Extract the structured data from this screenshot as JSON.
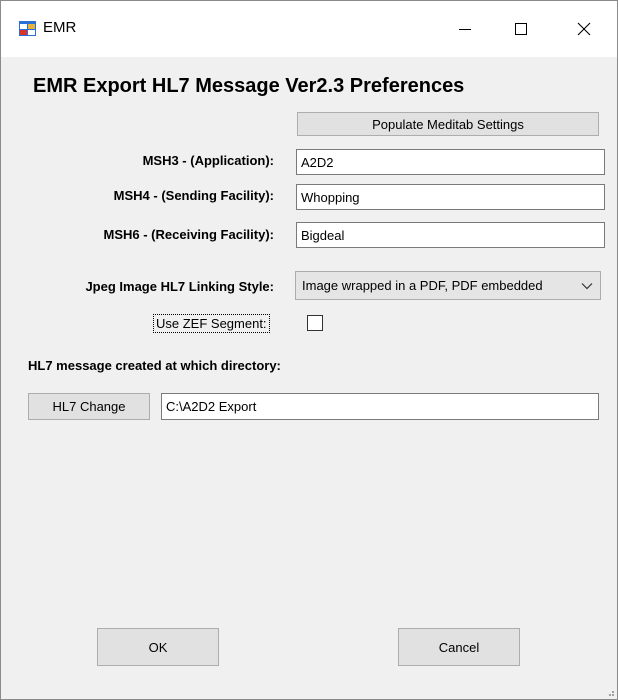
{
  "window": {
    "title": "EMR",
    "icon": "app-window-icon",
    "controls": {
      "minimize": "minimize-icon",
      "maximize": "maximize-icon",
      "close": "close-icon"
    }
  },
  "form": {
    "heading": "EMR Export HL7 Message Ver2.3 Preferences",
    "populate_button": "Populate Meditab Settings",
    "fields": [
      {
        "label": "MSH3 - (Application):",
        "value": "A2D2"
      },
      {
        "label": "MSH4 - (Sending Facility):",
        "value": "Whopping"
      },
      {
        "label": "MSH6 - (Receiving Facility):",
        "value": "Bigdeal"
      }
    ],
    "linking_style": {
      "label": "Jpeg Image HL7 Linking Style:",
      "selected": "Image wrapped in a PDF, PDF embedded"
    },
    "zef_segment": {
      "label": "Use ZEF Segment:",
      "checked": false
    },
    "directory": {
      "heading": "HL7 message created at which directory:",
      "change_button": "HL7 Change",
      "path": "C:\\A2D2 Export"
    },
    "ok_button": "OK",
    "cancel_button": "Cancel"
  },
  "colors": {
    "window_bg": "#f0f0f0",
    "button_bg": "#e1e1e1",
    "icon_blue": "#2a6fd6",
    "icon_red": "#d9322b"
  }
}
